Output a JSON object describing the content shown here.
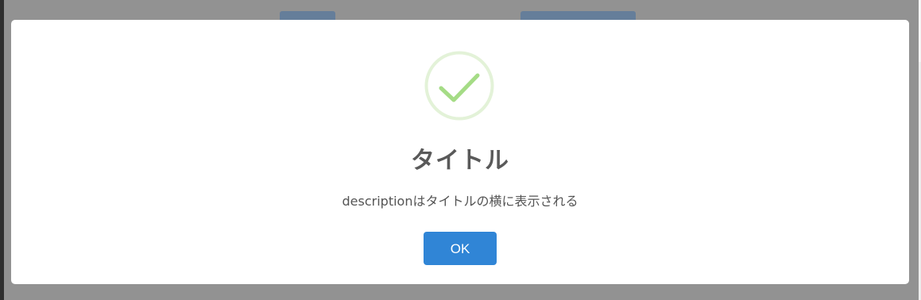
{
  "dialog": {
    "icon": "success-check-icon",
    "title": "タイトル",
    "description": "descriptionはタイトルの横に表示される",
    "confirm_label": "OK"
  },
  "colors": {
    "backdrop": "#929292",
    "modal_bg": "#ffffff",
    "success_ring": "#e3f2d8",
    "success_check": "#a5dc86",
    "title_text": "#595959",
    "description_text": "#545454",
    "confirm_button": "#3085d6",
    "confirm_text": "#ffffff"
  }
}
